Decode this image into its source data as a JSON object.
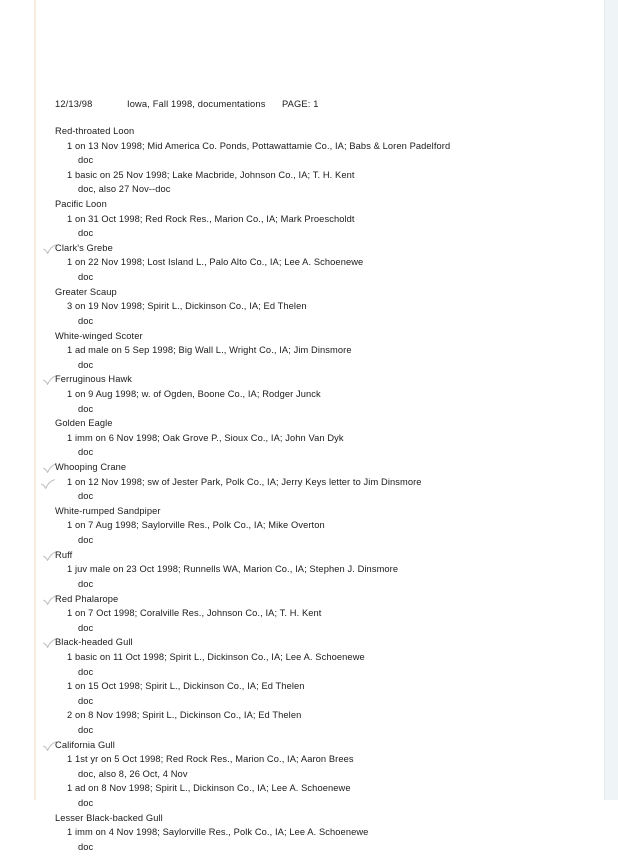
{
  "document": {
    "header": {
      "date": "12/13/98",
      "title": "Iowa, Fall 1998, documentations",
      "page": "PAGE: 1"
    },
    "lines": [
      {
        "kind": "species",
        "text": "Red-throated Loon",
        "check": false
      },
      {
        "kind": "record",
        "text": "1 on 13 Nov 1998; Mid America Co. Ponds, Pottawattamie Co., IA; Babs & Loren Padelford",
        "check": false
      },
      {
        "kind": "note",
        "text": "doc",
        "check": false
      },
      {
        "kind": "record",
        "text": "1 basic on 25 Nov 1998; Lake Macbride, Johnson Co., IA; T. H. Kent",
        "check": false
      },
      {
        "kind": "note",
        "text": "doc, also 27 Nov--doc",
        "check": false
      },
      {
        "kind": "species",
        "text": "Pacific Loon",
        "check": false
      },
      {
        "kind": "record",
        "text": "1 on 31 Oct 1998; Red Rock Res., Marion Co., IA; Mark Proescholdt",
        "check": false
      },
      {
        "kind": "note",
        "text": "doc",
        "check": false
      },
      {
        "kind": "species",
        "text": "Clark's Grebe",
        "check": true
      },
      {
        "kind": "record",
        "text": "1 on 22 Nov 1998; Lost Island L., Palo Alto Co., IA; Lee A. Schoenewe",
        "check": false
      },
      {
        "kind": "note",
        "text": "doc",
        "check": false
      },
      {
        "kind": "species",
        "text": "Greater Scaup",
        "check": false
      },
      {
        "kind": "record",
        "text": "3 on 19 Nov 1998; Spirit L., Dickinson Co., IA; Ed Thelen",
        "check": false
      },
      {
        "kind": "note",
        "text": "doc",
        "check": false
      },
      {
        "kind": "species",
        "text": "White-winged Scoter",
        "check": false
      },
      {
        "kind": "record",
        "text": "1 ad male on 5 Sep 1998; Big Wall L., Wright Co., IA; Jim Dinsmore",
        "check": false
      },
      {
        "kind": "note",
        "text": "doc",
        "check": false
      },
      {
        "kind": "species",
        "text": "Ferruginous Hawk",
        "check": true
      },
      {
        "kind": "record",
        "text": "1 on 9 Aug 1998; w. of Ogden, Boone Co., IA; Rodger Junck",
        "check": false
      },
      {
        "kind": "note",
        "text": "doc",
        "check": false
      },
      {
        "kind": "species",
        "text": "Golden Eagle",
        "check": false
      },
      {
        "kind": "record",
        "text": "1 imm on 6 Nov 1998; Oak Grove P., Sioux Co., IA; John Van Dyk",
        "check": false
      },
      {
        "kind": "note",
        "text": "doc",
        "check": false
      },
      {
        "kind": "species",
        "text": "Whooping Crane",
        "check": true
      },
      {
        "kind": "record",
        "text": "1 on 12 Nov 1998; sw of Jester Park, Polk Co., IA; Jerry Keys letter to Jim Dinsmore",
        "check": true
      },
      {
        "kind": "note",
        "text": "doc",
        "check": false
      },
      {
        "kind": "species",
        "text": "White-rumped Sandpiper",
        "check": false
      },
      {
        "kind": "record",
        "text": "1 on 7 Aug 1998; Saylorville Res., Polk Co., IA; Mike Overton",
        "check": false
      },
      {
        "kind": "note",
        "text": "doc",
        "check": false
      },
      {
        "kind": "species",
        "text": "Ruff",
        "check": true
      },
      {
        "kind": "record",
        "text": "1 juv male on 23 Oct 1998; Runnells WA, Marion Co., IA; Stephen J. Dinsmore",
        "check": false
      },
      {
        "kind": "note",
        "text": "doc",
        "check": false
      },
      {
        "kind": "species",
        "text": "Red Phalarope",
        "check": true
      },
      {
        "kind": "record",
        "text": "1 on 7 Oct 1998; Coralville Res., Johnson Co., IA; T. H. Kent",
        "check": false
      },
      {
        "kind": "note",
        "text": "doc",
        "check": false
      },
      {
        "kind": "species",
        "text": "Black-headed Gull",
        "check": true
      },
      {
        "kind": "record",
        "text": "1 basic on 11 Oct 1998; Spirit L., Dickinson Co., IA; Lee A. Schoenewe",
        "check": false
      },
      {
        "kind": "note",
        "text": "doc",
        "check": false
      },
      {
        "kind": "record",
        "text": "1 on 15 Oct 1998; Spirit L., Dickinson Co., IA; Ed Thelen",
        "check": false
      },
      {
        "kind": "note",
        "text": "doc",
        "check": false
      },
      {
        "kind": "record",
        "text": "2 on 8 Nov 1998; Spirit L., Dickinson Co., IA; Ed Thelen",
        "check": false
      },
      {
        "kind": "note",
        "text": "doc",
        "check": false
      },
      {
        "kind": "species",
        "text": "California Gull",
        "check": true
      },
      {
        "kind": "record",
        "text": "1 1st yr on 5 Oct 1998; Red Rock Res., Marion Co., IA; Aaron Brees",
        "check": false
      },
      {
        "kind": "note",
        "text": "doc, also 8, 26 Oct, 4 Nov",
        "check": false
      },
      {
        "kind": "record",
        "text": "1 ad on 8 Nov 1998; Spirit L., Dickinson Co., IA; Lee A. Schoenewe",
        "check": false
      },
      {
        "kind": "note",
        "text": "doc",
        "check": false
      },
      {
        "kind": "species",
        "text": "Lesser Black-backed Gull",
        "check": false
      },
      {
        "kind": "record",
        "text": "1 imm on 4 Nov 1998; Saylorville Res., Polk Co., IA; Lee A. Schoenewe",
        "check": false
      },
      {
        "kind": "note",
        "text": "doc",
        "check": false
      }
    ]
  }
}
